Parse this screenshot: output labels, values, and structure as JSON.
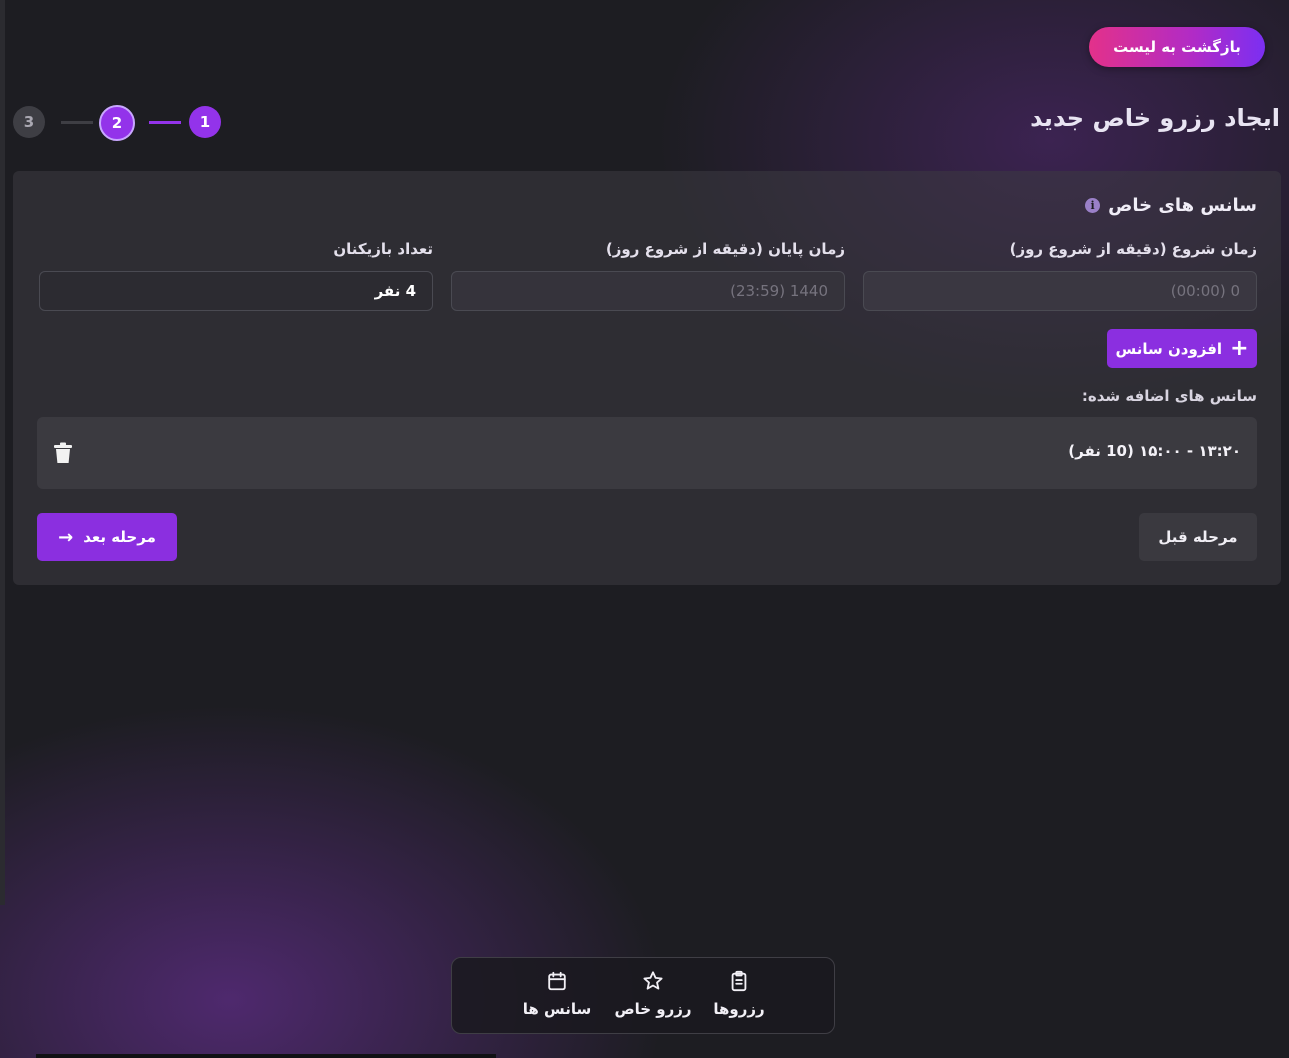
{
  "header": {
    "back_button": "بازگشت به لیست",
    "title": "ایجاد رزرو خاص جدید"
  },
  "stepper": {
    "steps": [
      "1",
      "2",
      "3"
    ],
    "current_step": 2
  },
  "form": {
    "section_title": "سانس های خاص",
    "start_time": {
      "label": "زمان شروع (دقیقه از شروع روز)",
      "placeholder": "0 (00:00)"
    },
    "end_time": {
      "label": "زمان پایان (دقیقه از شروع روز)",
      "placeholder": "1440 (23:59)"
    },
    "players": {
      "label": "تعداد بازیکنان",
      "value": "4 نفر"
    },
    "add_button": "افزودن سانس",
    "added_sessions_label": "سانس های اضافه شده:",
    "sessions": [
      {
        "text": "۱۳:۲۰ - ۱۵:۰۰ (10 نفر)"
      }
    ],
    "prev_button": "مرحله قبل",
    "next_button": "مرحله بعد"
  },
  "bottom_nav": {
    "items": [
      {
        "label": "رزروها",
        "icon": "clipboard-icon"
      },
      {
        "label": "رزرو خاص",
        "icon": "star-icon"
      },
      {
        "label": "سانس ها",
        "icon": "calendar-icon"
      }
    ]
  },
  "colors": {
    "accent": "#8b2fe0",
    "background": "#1d1d22",
    "back_button_gradient": [
      "#e3318a",
      "#7b2ff2"
    ]
  }
}
